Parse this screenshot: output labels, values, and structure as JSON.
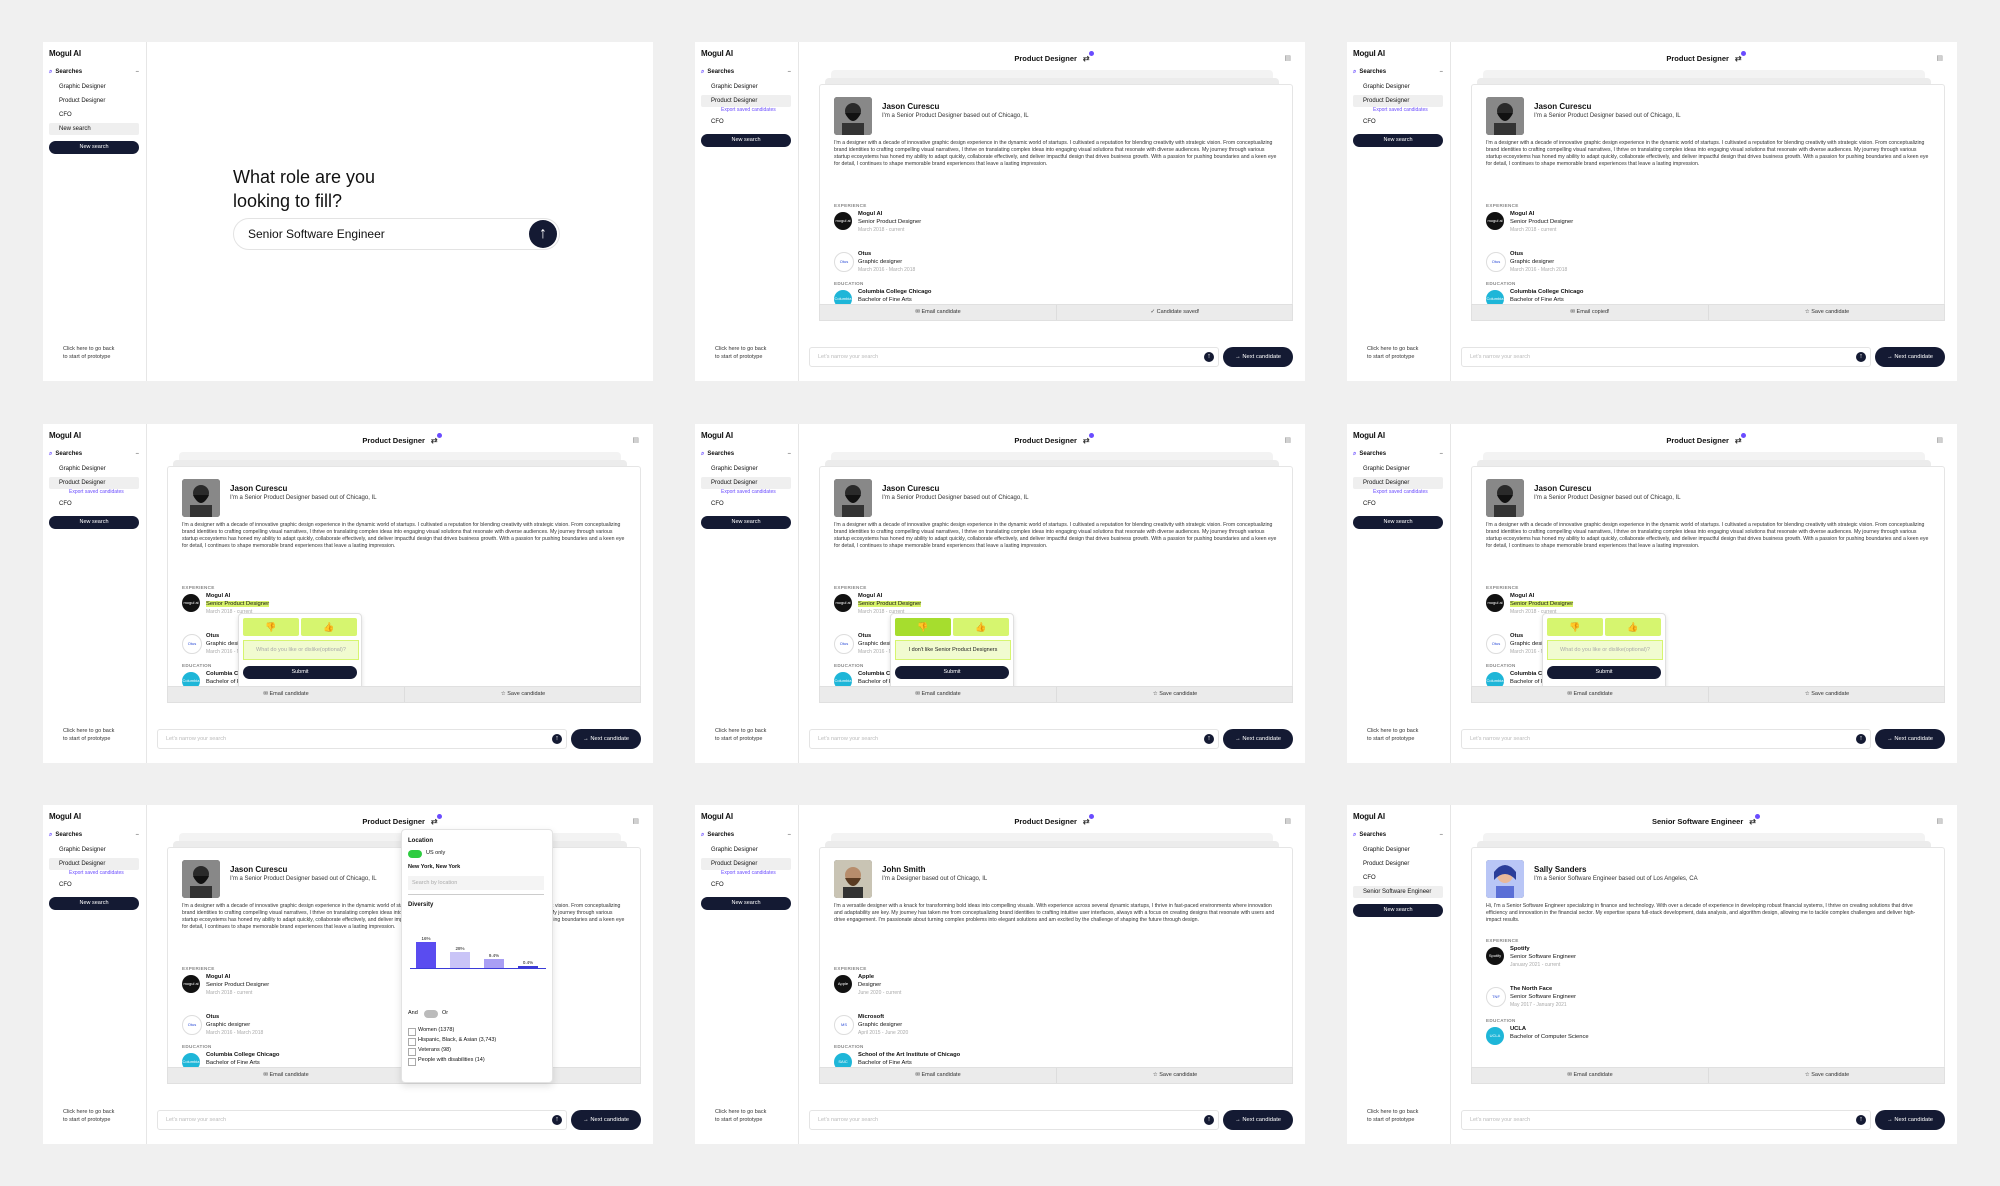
{
  "app": {
    "logo": "Mogul AI"
  },
  "sidebar": {
    "searches_label": "Searches",
    "items_default": [
      "Graphic Designer",
      "Product Designer",
      "CFO"
    ],
    "item_new_search": "New search",
    "export_link": "Export saved candidates",
    "item_senior_engineer": "Senior Software Engineer",
    "new_search_button": "New search",
    "back_link": "Click here to go back to start of prototype"
  },
  "home": {
    "heading": "What role are you looking to fill?",
    "input_value": "Senior Software Engineer"
  },
  "header": {
    "title_product": "Product Designer",
    "title_engineer": "Senior Software Engineer"
  },
  "candidate_jason": {
    "name": "Jason Curescu",
    "tagline": "I'm a Senior Product Designer based out of Chicago, IL",
    "bio": "I'm a designer with a decade of innovative graphic design experience in the dynamic world of startups. I cultivated a reputation for blending creativity with strategic vision. From conceptualizing brand identities to crafting compelling visual narratives, I thrive on translating complex ideas into engaging visual solutions that resonate with diverse audiences. My journey through various startup ecosystems has honed my ability to adapt quickly, collaborate effectively, and deliver impactful design that drives business growth. With a passion for pushing boundaries and a keen eye for detail, I continues to shape memorable brand experiences that leave a lasting impression.",
    "experience_label": "EXPERIENCE",
    "exp": [
      {
        "icon": "mogul ai",
        "company": "Mogul AI",
        "role": "Senior Product Designer",
        "dates": "March 2018 - current"
      },
      {
        "icon": "Otus",
        "company": "Otus",
        "role": "Graphic designer",
        "dates": "March 2016 - March 2018"
      }
    ],
    "education_label": "EDUCATION",
    "edu": {
      "icon": "Columbia",
      "school": "Columbia College Chicago",
      "degree": "Bachelor of Fine Arts"
    }
  },
  "candidate_john": {
    "name": "John Smith",
    "tagline": "I'm a Designer based out of Chicago, IL",
    "bio": "I'm a versatile designer with a knack for transforming bold ideas into compelling visuals. With experience across several dynamic startups, I thrive in fast-paced environments where innovation and adaptability are key. My journey has taken me from conceptualizing brand identities to crafting intuitive user interfaces, always with a focus on creating designs that resonate with users and drive engagement. I'm passionate about turning complex problems into elegant solutions and am excited by the challenge of shaping the future through design.",
    "exp": [
      {
        "icon": "Apple",
        "company": "Apple",
        "role": "Designer",
        "dates": "June 2020 - current"
      },
      {
        "icon": "MS",
        "company": "Microsoft",
        "role": "Graphic designer",
        "dates": "April 2015 - June 2020"
      }
    ],
    "edu": {
      "icon": "SAIC",
      "school": "School of the Art Institute of Chicago",
      "degree": "Bachelor of Fine Arts"
    }
  },
  "candidate_sally": {
    "name": "Sally Sanders",
    "tagline": "I'm a Senior Software Engineer based out of Los Angeles, CA",
    "bio": "Hi, I'm a Senior Software Engineer specializing in finance and technology. With over a decade of experience in developing robust financial systems, I thrive on creating solutions that drive efficiency and innovation in the financial sector. My expertise spans full-stack development, data analysis, and algorithm design, allowing me to tackle complex challenges and deliver high-impact results.",
    "exp": [
      {
        "icon": "Spotify",
        "company": "Spotify",
        "role": "Senior Software Engineer",
        "dates": "January 2021 - current"
      },
      {
        "icon": "TNF",
        "company": "The North Face",
        "role": "Senior Software Engineer",
        "dates": "May 2017 - January 2021"
      }
    ],
    "edu": {
      "icon": "UCLA",
      "school": "UCLA",
      "degree": "Bachelor of Computer Science"
    }
  },
  "actions": {
    "email": "✉ Email candidate",
    "email_copied": "✉ Email copied!",
    "save": "☆ Save candidate",
    "saved": "✓ Candidate saved!",
    "chat_placeholder": "Let's narrow your search",
    "next": "→  Next candidate"
  },
  "feedback": {
    "placeholder": "What do you like or dislike(optional)?",
    "typed": "I don't like Senior Product Designers",
    "submit": "Submit",
    "thumbs_down": "👎",
    "thumbs_up": "👍"
  },
  "filter": {
    "location_label": "Location",
    "us_only": "US only",
    "city": "New York, New York",
    "search_placeholder": "Search by location",
    "diversity_label": "Diversity",
    "bar_values": [
      "16%",
      "28%",
      "9.4%",
      "0.4%"
    ],
    "bar_levels": [
      0.57,
      0.35,
      0.2,
      0.05
    ],
    "and_label": "And",
    "or_label": "Or",
    "options": [
      "Women (1378)",
      "Hispanic, Black, & Asian (3,743)",
      "Veterans (98)",
      "People with disabilities (14)"
    ]
  },
  "colors": {
    "accent": "#6a4cff",
    "dark": "#141a33",
    "highlight": "#d8f36a"
  }
}
